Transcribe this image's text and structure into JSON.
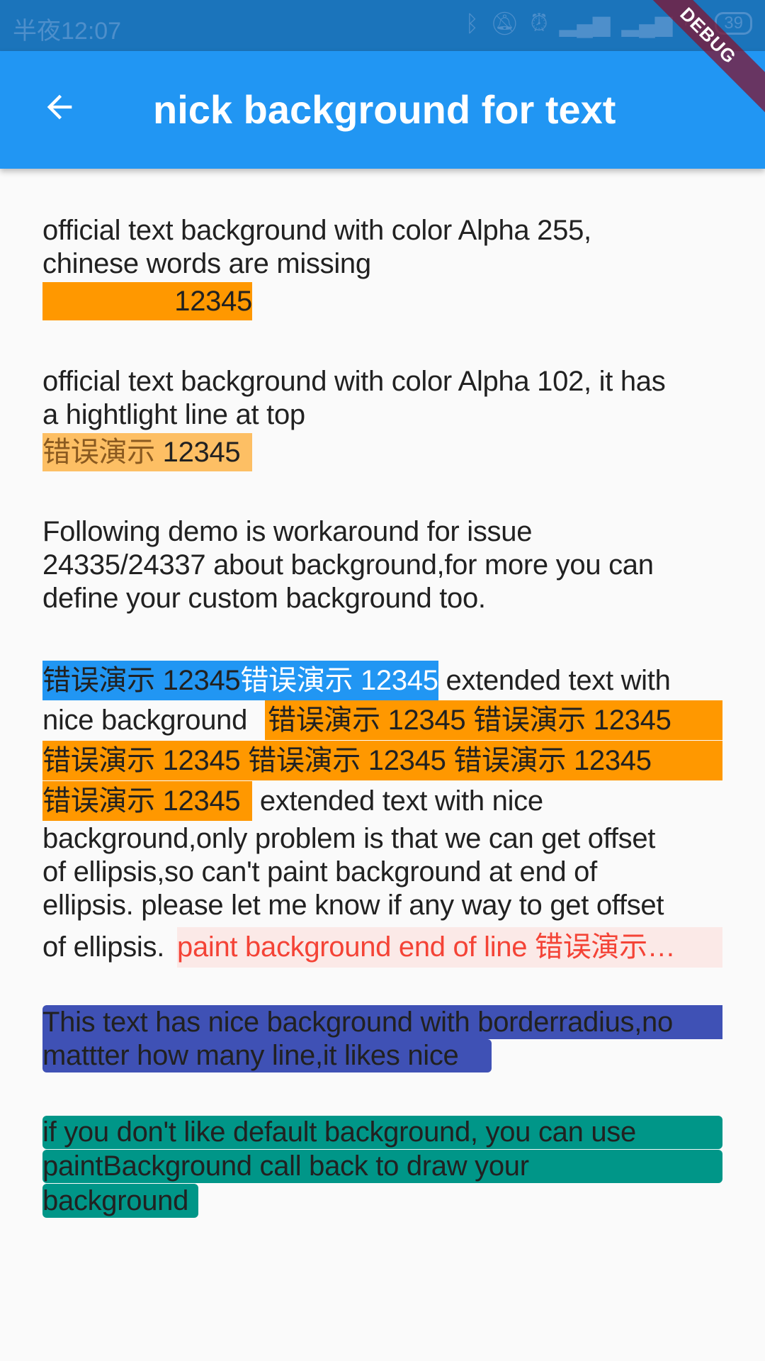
{
  "status_bar": {
    "time": "半夜12:07",
    "battery": "39",
    "icons": [
      "bluetooth-icon",
      "mute-icon",
      "alarm-icon",
      "signal-icon",
      "signal-icon",
      "wifi-icon",
      "battery-icon"
    ]
  },
  "debug_banner": "DEBUG",
  "app_bar": {
    "title": "nick background for text",
    "back_icon": "arrow-back-icon"
  },
  "colors": {
    "app_bar": "#2196F3",
    "orange": "#FF9800",
    "blue": "#2196F3",
    "red": "#F44336",
    "red_bg": "#FBE9E7",
    "indigo": "#3F51B5",
    "teal": "#009688"
  },
  "section1": {
    "lines": [
      "official text background with color Alpha 255,",
      "chinese words are missing"
    ],
    "sample": "12345"
  },
  "section2": {
    "lines": [
      "official text background with color Alpha 102, it has",
      "a hightlight line at top"
    ],
    "sample_cn": "错误演示",
    "sample_num": " 12345"
  },
  "section3": {
    "lines": [
      "Following demo is workaround for issue",
      "24335/24337 about background,for more you can",
      "define your custom background too."
    ]
  },
  "section4": {
    "blue_a": "错误演示 12345",
    "blue_b": "错误演示 12345",
    "after_blue": " extended text with",
    "line2_text": "nice background ",
    "orange_item": "错误演示 12345 ",
    "after_orange": " extended text with nice",
    "lines": [
      "background,only problem is that we can get offset",
      "of ellipsis,so can't paint background at end of",
      "ellipsis. please let me know if any way to get offset"
    ],
    "last_prefix": "of ellipsis.",
    "ellipsis_text": "paint background end of line 错误演示…"
  },
  "section5": {
    "lines": [
      "This text has nice background with borderradius,no",
      "mattter how many line,it likes nice"
    ]
  },
  "section6": {
    "lines": [
      "if you don't like default background, you can use",
      "paintBackground call back to draw your",
      "background"
    ]
  }
}
